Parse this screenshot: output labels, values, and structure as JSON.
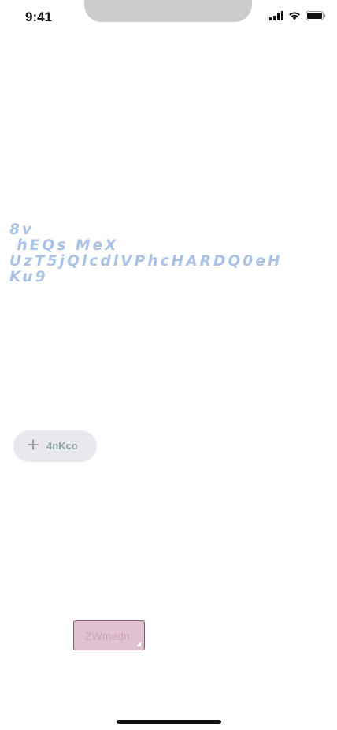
{
  "status_bar": {
    "time": "9:41",
    "icons": [
      "cellular-signal-icon",
      "wifi-icon",
      "battery-icon"
    ]
  },
  "headline": {
    "text": "8v\n hEQs MeX\nUzT5jQlcdlVPhcHARDQ0eH\nKu9"
  },
  "chip_button": {
    "icon": "plus-icon",
    "label": "4nKco"
  },
  "resizable_box": {
    "label": "ZWmedn"
  },
  "colors": {
    "headline": "#a9c2e6",
    "chip_background": "#e9e8ee",
    "chip_text": "#8fa8a4",
    "box_background": "#dfc1d0",
    "box_border": "#8a5a74",
    "box_text": "#c9a7b8",
    "notch": "#cccccc"
  }
}
